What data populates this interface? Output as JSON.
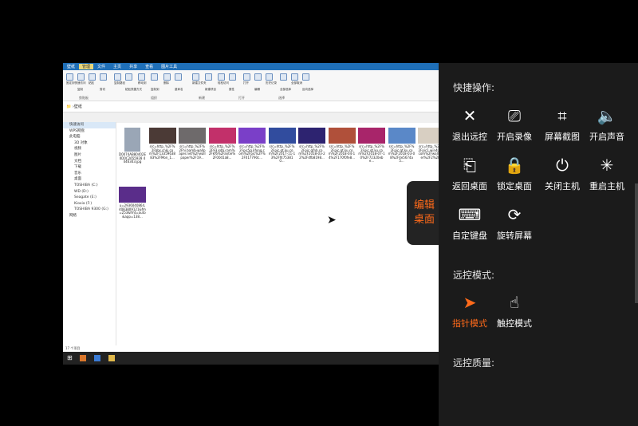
{
  "remote": {
    "window_title": "壁纸",
    "ribbon_tabs": [
      "文件",
      "主页",
      "共享",
      "查看",
      "图片工具"
    ],
    "context_tab": "管理",
    "ribbon_buttons": [
      "固定到快速访问",
      "复制",
      "粘贴",
      "剪切",
      "复制路径",
      "粘贴快捷方式",
      "移动到",
      "复制到",
      "删除",
      "重命名",
      "新建文件夹",
      "新建项目",
      "轻松访问",
      "属性",
      "打开",
      "编辑",
      "历史记录",
      "全部选择",
      "全部取消",
      "反向选择"
    ],
    "ribbon_groups": [
      "剪贴板",
      "组织",
      "新建",
      "打开",
      "选择"
    ],
    "address": "壁纸",
    "nav_items": [
      {
        "label": "快速访问",
        "header": true,
        "selected": true
      },
      {
        "label": "WPS网盘",
        "header": true
      },
      {
        "label": "此电脑",
        "header": true
      },
      {
        "label": "3D 对象"
      },
      {
        "label": "视频"
      },
      {
        "label": "图片"
      },
      {
        "label": "文档"
      },
      {
        "label": "下载"
      },
      {
        "label": "音乐"
      },
      {
        "label": "桌面"
      },
      {
        "label": "TOSHIBA (C:)"
      },
      {
        "label": "WD (D:)"
      },
      {
        "label": "Seagate (E:)"
      },
      {
        "label": "Kioxia (F:)"
      },
      {
        "label": "TOSHIBA 9300 (G:)"
      },
      {
        "label": "网络",
        "header": true
      }
    ],
    "files": [
      {
        "name": "D0074AB80402E0D0C2655928 4446343.jpg",
        "color": "#9aa6b6"
      },
      {
        "name": "src=http_%2F%2Fbbs.cnkj.com%2F1335963883%2FMon_1...",
        "color": "#4b3a36"
      },
      {
        "name": "src=http_%2F%2Fhi.bamb-wallpaper.net%2Fwallpaper%2F19...",
        "color": "#6e6a6b"
      },
      {
        "name": "src=http_%2F%2F93.kdb.com%2Fkf6%2Fantie%2F00d1a8...",
        "color": "#c2306a"
      },
      {
        "name": "src=http_%2F%2Fpic5g.kfong.com%2Fpic%2F%2F017790c...",
        "color": "#7a3fc8"
      },
      {
        "name": "src=http_%2F%2Fpic.qt.ku.com%2F2017-11-13%2Ff4753810...",
        "color": "#314c9e"
      },
      {
        "name": "src=http_%2F%2Fpic.qfnb.com%2F2018-03-22%2Fdfb8198...",
        "color": "#2d2370"
      },
      {
        "name": "src=http_%2F%2Fpic.qt.ku.com%2F2018-04-14%2F170f0fe8...",
        "color": "#b0503a"
      },
      {
        "name": "src=http_%2F%2Fpic.qt.ku.com%2F2018-07-10%2F72320ebe...",
        "color": "#a8256a"
      },
      {
        "name": "src=http_%2F%2Fpic.qt.ku.com%2F2018-03-08%2F4e5674a5...",
        "color": "#5a88c8"
      },
      {
        "name": "src=http_%2F%2Fpic1.win4000.com%2Fwallpaper%2F2%2F...",
        "color": "#d8cfc2"
      },
      {
        "name": "u=2936040864, 4083809121&fm=253&fmt=auto&app=138...",
        "color": "#5a2d8a"
      }
    ],
    "status": "17 个项目"
  },
  "panel": {
    "edit_label_1": "编辑",
    "edit_label_2": "桌面",
    "quick_title": "快捷操作:",
    "quick_actions": [
      {
        "label": "退出远控",
        "icon": "close-icon",
        "glyph": "✕"
      },
      {
        "label": "开启录像",
        "icon": "video-camera-icon",
        "glyph": "⎚"
      },
      {
        "label": "屏幕截图",
        "icon": "crop-icon",
        "glyph": "⌗"
      },
      {
        "label": "开启声音",
        "icon": "speaker-icon",
        "glyph": "🔈"
      },
      {
        "label": "返回桌面",
        "icon": "desktop-return-icon",
        "glyph": "⎗"
      },
      {
        "label": "锁定桌面",
        "icon": "lock-icon",
        "glyph": "🔒"
      },
      {
        "label": "关闭主机",
        "icon": "power-icon",
        "glyph": "⏻"
      },
      {
        "label": "重启主机",
        "icon": "restart-spinner-icon",
        "glyph": "✳"
      },
      {
        "label": "自定键盘",
        "icon": "keyboard-icon",
        "glyph": "⌨"
      },
      {
        "label": "旋转屏幕",
        "icon": "rotate-screen-icon",
        "glyph": "⟳"
      }
    ],
    "mode_title": "远控模式:",
    "modes": [
      {
        "label": "指针模式",
        "icon": "pointer-icon",
        "glyph": "➤",
        "active": true
      },
      {
        "label": "触控模式",
        "icon": "touch-hand-icon",
        "glyph": "☝",
        "active": false
      }
    ],
    "quality_title": "远控质量:"
  },
  "colors": {
    "accent": "#ff6a1a",
    "panel_bg": "#1b1b1b",
    "ribbon_blue": "#1f6fb8"
  }
}
